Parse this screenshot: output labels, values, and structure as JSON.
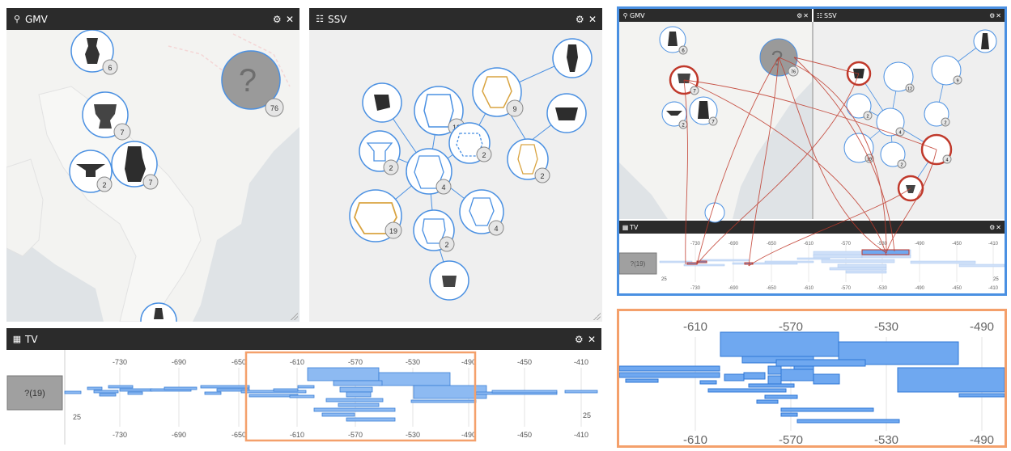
{
  "gmv": {
    "title": "GMV",
    "icon": "map-marker-icon"
  },
  "ssv": {
    "title": "SSV",
    "icon": "sitemap-icon"
  },
  "tv": {
    "title": "TV",
    "icon": "calendar-icon",
    "bucket_label": "?(19)",
    "left_count": "25",
    "right_count": "25",
    "ticks": [
      "-730",
      "-690",
      "-650",
      "-610",
      "-570",
      "-530",
      "-490",
      "-450",
      "-410"
    ]
  },
  "controls": {
    "settings": "⚙",
    "close": "✕"
  },
  "gmv_clusters": [
    {
      "count": "6"
    },
    {
      "count": "7"
    },
    {
      "count": "2"
    },
    {
      "count": "7"
    },
    {
      "count": "76",
      "label": "?"
    }
  ],
  "ssv_nodes": [
    {
      "count": "12"
    },
    {
      "count": "9"
    },
    {
      "count": "2"
    },
    {
      "count": "2"
    },
    {
      "count": "2"
    },
    {
      "count": "4"
    },
    {
      "count": "19"
    },
    {
      "count": "2"
    },
    {
      "count": "4"
    }
  ],
  "mini": {
    "gmv_title": "GMV",
    "ssv_title": "SSV",
    "tv_title": "TV",
    "tv_bucket": "?(19)",
    "left_count": "25",
    "right_count": "25",
    "gmv_counts": [
      "6",
      "7",
      "2",
      "7",
      "76"
    ],
    "gmv_unknown": "?",
    "ssv_counts": [
      "12",
      "9",
      "2",
      "2",
      "4",
      "19",
      "2",
      "4"
    ],
    "ticks": [
      "-730",
      "-690",
      "-650",
      "-610",
      "-570",
      "-530",
      "-490",
      "-450",
      "-410"
    ]
  },
  "zoom": {
    "ticks": [
      "-610",
      "-570",
      "-530",
      "-490"
    ]
  },
  "colors": {
    "header": "#2b2b2b",
    "bar": "#6fa8f0",
    "highlight_orange": "#f4a06b",
    "highlight_blue": "#4a90e2",
    "link_red": "#c0392b"
  }
}
